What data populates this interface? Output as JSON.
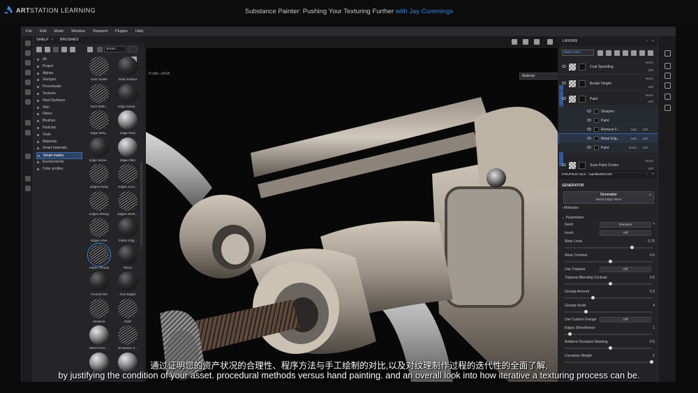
{
  "banner": {
    "brand_bold": "ART",
    "brand_rest": "STATION LEARNING",
    "course_title": "Substance Painter: Pushing Your Texturing Further ",
    "with": "with ",
    "author": "Jay Cummings",
    "author_color": "#3a86d8"
  },
  "menu": [
    "File",
    "Edit",
    "Mode",
    "Window",
    "Viewport",
    "Plugins",
    "Help"
  ],
  "shelf": {
    "tab_shelf": "SHELF",
    "tab_brushes": "BRUSHES",
    "search_value": "Smart...",
    "categories": [
      "All",
      "Project",
      "Alphas",
      "Grunges",
      "Procedurals",
      "Textures",
      "Hard Surfaces",
      "Skin",
      "Filters",
      "Brushes",
      "Particles",
      "Tools",
      "Materials",
      "Smart materials",
      "Smart masks",
      "Environments",
      "Color profiles"
    ],
    "selected_category": "Smart masks",
    "thumbnails": [
      "Dust Subtle",
      "Dust Surface",
      "Dust Wide...",
      "Edge Dama...",
      "Edge Dirty...",
      "Edge Rust",
      "Edge Stone...",
      "Edges Blur",
      "Edges Dusty",
      "Edges Scra...",
      "Edges Strong",
      "Edges Stron...",
      "Edges Uber",
      "Fabric Edg...",
      "Fabric Thread",
      "Fibers",
      "Ground Dirt",
      "Gun Edges",
      "Moisture",
      "Mold",
      "Moss From ...",
      "Occlusion S...",
      "",
      ""
    ],
    "selected_thumbnail": "Fabric Thread"
  },
  "viewport": {
    "profile": "Profile: sRGB",
    "material_select": "Material"
  },
  "layers": {
    "title": "LAYERS",
    "blend_mode": "Base Color",
    "rows": [
      {
        "name": "Coat Speckling",
        "mode": "Norm",
        "opacity": "100"
      },
      {
        "name": "Border Height",
        "mode": "Norm",
        "opacity": "100"
      },
      {
        "name": "Paint",
        "mode": "Norm",
        "opacity": "100"
      },
      {
        "name": "Sharpen",
        "mode": "",
        "opacity": ""
      },
      {
        "name": "Paint",
        "mode": "",
        "opacity": ""
      },
      {
        "name": "Remove F...",
        "mode": "Sub",
        "opacity": "100"
      },
      {
        "name": "Metal Edg...",
        "mode": "Sub",
        "opacity": "100"
      },
      {
        "name": "Paint",
        "mode": "Norm",
        "opacity": "100"
      },
      {
        "name": "Scan Paint Cracks",
        "mode": "Norm",
        "opacity": "100"
      }
    ]
  },
  "properties": {
    "title": "PROPERTIES - GENERATOR",
    "section": "GENERATOR",
    "generator_label": "Generator",
    "generator_value": "Metal Edge Wear",
    "attributes": "Attributes",
    "parameters": "Parameters",
    "seed_label": "Seed",
    "seed_value": "Random",
    "invert_label": "Invert",
    "invert_value": "Off",
    "wear_level_label": "Wear Level",
    "wear_level_value": "0.75",
    "wear_contrast_label": "Wear Contrast",
    "wear_contrast_value": "0.5",
    "triplanar_label": "Use Triplanar",
    "triplanar_value": "Off",
    "triplanar_blend_label": "Triplanar Blending Contrast",
    "triplanar_blend_value": "0.5",
    "grunge_amount_label": "Grunge Amount",
    "grunge_amount_value": "0.3",
    "grunge_scale_label": "Grunge Scale",
    "grunge_scale_value": "4",
    "custom_grunge_label": "Use Custom Grunge",
    "custom_grunge_value": "Off",
    "edges_smooth_label": "Edges Smoothness",
    "edges_smooth_value": "1",
    "ao_masking_label": "Ambient Occlusion Masking",
    "ao_masking_value": "0.5",
    "curvature_label": "Curvature Weight",
    "curvature_value": "1"
  },
  "subtitles": {
    "cn": "通过证明您的资产状况的合理性、程序方法与手工绘制的对比,以及对纹理制作过程的迭代性的全面了解,",
    "en": "by justifying the condition of your asset. procedural methods versus hand painting. and an overall look into how iterative a texturing process can be."
  }
}
